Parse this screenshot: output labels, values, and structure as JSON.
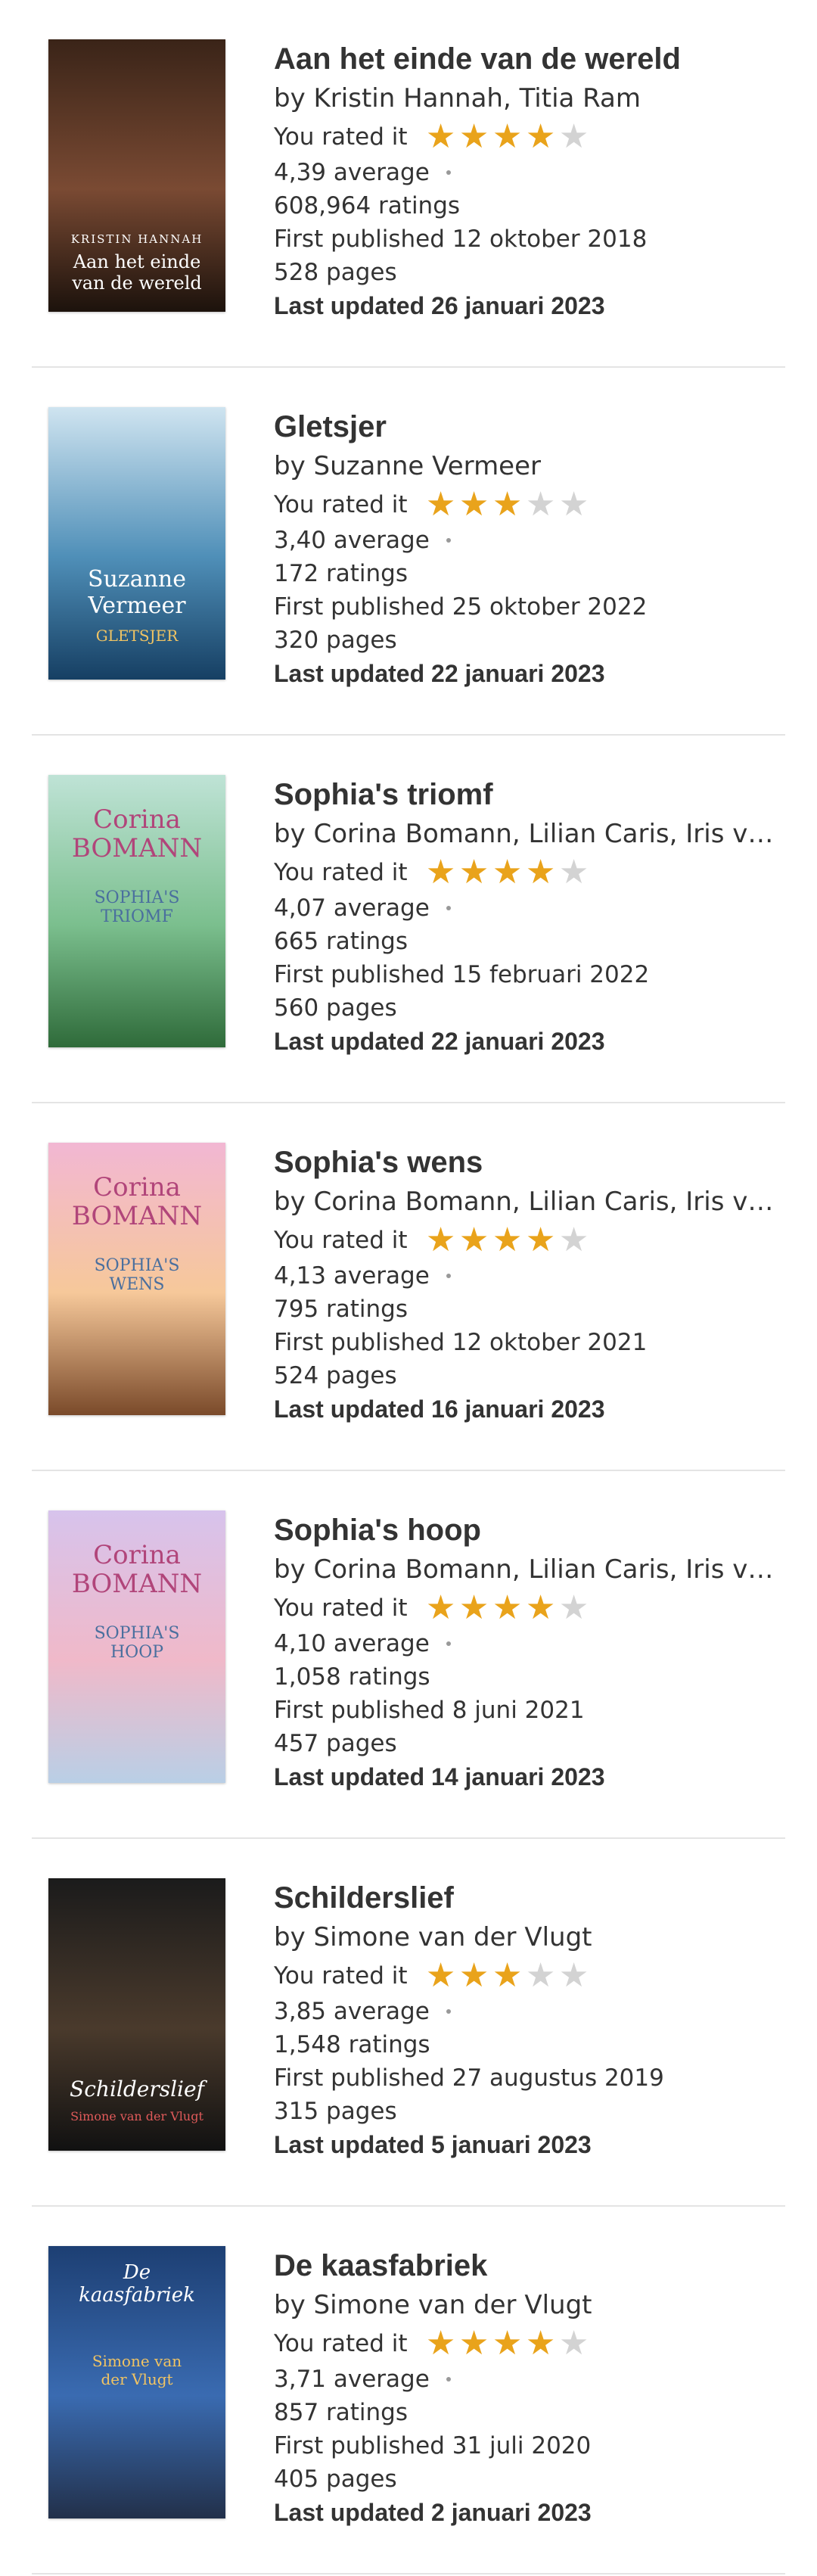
{
  "rated_label": "You rated it",
  "books": [
    {
      "title": "Aan het einde van de wereld",
      "authors": "by Kristin Hannah, Titia Ram",
      "rating": 4,
      "average": "4,39 average",
      "ratings": "608,964 ratings",
      "published": "First published 12 oktober 2018",
      "pages": "528 pages",
      "updated": "Last updated 26 januari 2023",
      "cover_colors": [
        "#3a2418",
        "#7a4a33",
        "#1c120c"
      ],
      "cover_author": "KRISTIN HANNAH",
      "cover_title": "Aan het einde van de wereld"
    },
    {
      "title": "Gletsjer",
      "authors": "by Suzanne Vermeer",
      "rating": 3,
      "average": "3,40 average",
      "ratings": "172 ratings",
      "published": "First published 25 oktober 2022",
      "pages": "320 pages",
      "updated": "Last updated 22 januari 2023",
      "cover_colors": [
        "#cfe4f0",
        "#4f8fb8",
        "#163f63"
      ],
      "cover_author": "Suzanne Vermeer",
      "cover_title": "GLETSJER"
    },
    {
      "title": "Sophia's triomf",
      "authors": "by Corina Bomann, Lilian Caris, Iris van der Blom",
      "rating": 4,
      "average": "4,07 average",
      "ratings": "665 ratings",
      "published": "First published 15 februari 2022",
      "pages": "560 pages",
      "updated": "Last updated 22 januari 2023",
      "cover_colors": [
        "#bfe3d6",
        "#7bbf8e",
        "#2f6b3a"
      ],
      "cover_author": "Corina BOMANN",
      "cover_title": "SOPHIA'S TRIOMF"
    },
    {
      "title": "Sophia's wens",
      "authors": "by Corina Bomann, Lilian Caris, Iris van der Blom",
      "rating": 4,
      "average": "4,13 average",
      "ratings": "795 ratings",
      "published": "First published 12 oktober 2021",
      "pages": "524 pages",
      "updated": "Last updated 16 januari 2023",
      "cover_colors": [
        "#f2b7d3",
        "#f6c89a",
        "#7a4a2a"
      ],
      "cover_author": "Corina BOMANN",
      "cover_title": "SOPHIA'S WENS"
    },
    {
      "title": "Sophia's hoop",
      "authors": "by Corina Bomann, Lilian Caris, Iris van der Blom",
      "rating": 4,
      "average": "4,10 average",
      "ratings": "1,058 ratings",
      "published": "First published 8 juni 2021",
      "pages": "457 pages",
      "updated": "Last updated 14 januari 2023",
      "cover_colors": [
        "#d7c3ec",
        "#f0b9c9",
        "#b9cfe6"
      ],
      "cover_author": "Corina BOMANN",
      "cover_title": "SOPHIA'S HOOP"
    },
    {
      "title": "Schilderslief",
      "authors": "by Simone van der Vlugt",
      "rating": 3,
      "average": "3,85 average",
      "ratings": "1,548 ratings",
      "published": "First published 27 augustus 2019",
      "pages": "315 pages",
      "updated": "Last updated 5 januari 2023",
      "cover_colors": [
        "#1b1b1b",
        "#4a3a2c",
        "#111111"
      ],
      "cover_author": "Simone van der Vlugt",
      "cover_title": "Schilderslief"
    },
    {
      "title": "De kaasfabriek",
      "authors": "by Simone van der Vlugt",
      "rating": 4,
      "average": "3,71 average",
      "ratings": "857 ratings",
      "published": "First published 31 juli 2020",
      "pages": "405 pages",
      "updated": "Last updated 2 januari 2023",
      "cover_colors": [
        "#1d3f73",
        "#3a6bb1",
        "#22304a"
      ],
      "cover_author": "Simone van der Vlugt",
      "cover_title": "De kaasfabriek"
    }
  ],
  "star_color_on": "#e9a31b",
  "star_color_off": "#d3d3d3"
}
